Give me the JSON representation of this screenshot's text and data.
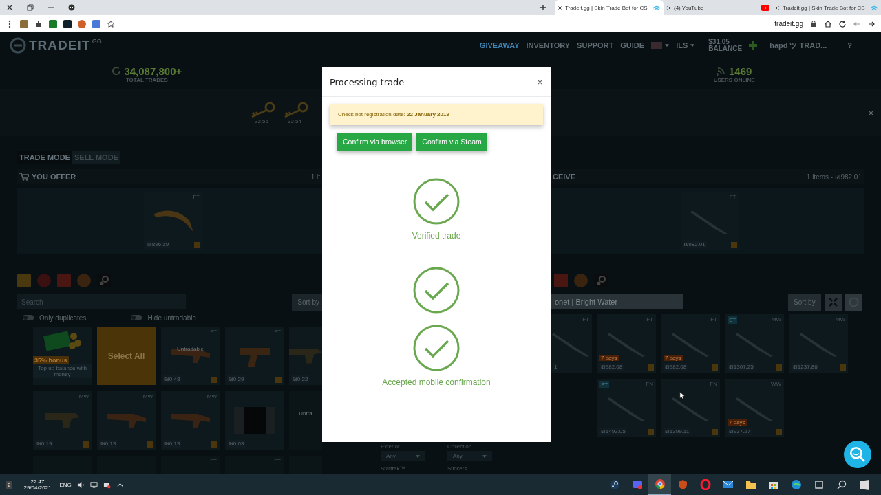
{
  "browser": {
    "tabs": [
      {
        "title": "Tradeit.gg | Skin Trade Bot for CS",
        "kind": "tradeit",
        "selected": true
      },
      {
        "title": "(4) YouTube",
        "kind": "youtube",
        "selected": false
      },
      {
        "title": "Tradeit.gg | Skin Trade Bot for CS",
        "kind": "tradeit",
        "selected": false
      }
    ],
    "address": "tradeit.gg"
  },
  "site": {
    "logo": "TRADEIT",
    "logo_suffix": ".GG",
    "nav": [
      {
        "label": "GIVEAWAY",
        "highlighted": true
      },
      {
        "label": "INVENTORY",
        "highlighted": false
      },
      {
        "label": "SUPPORT",
        "highlighted": false
      },
      {
        "label": "GUIDE",
        "highlighted": false
      }
    ],
    "currency": "ILS",
    "balance": "$31.05",
    "balance_label": "BALANCE",
    "user": "hapd ツ TRAD...",
    "help": "?"
  },
  "stats": [
    {
      "kind": "trades",
      "value": "34,087,800+",
      "label": "TOTAL TRADES"
    },
    {
      "kind": "online",
      "value": "1469",
      "label": "USERS ONLINE"
    }
  ],
  "keys": [
    {
      "price": "32.55"
    },
    {
      "price": "32.54"
    }
  ],
  "modes": [
    {
      "label": "TRADE MODE",
      "selected": true
    },
    {
      "label": "SELL MODE",
      "selected": false
    }
  ],
  "offer": {
    "title": "YOU OFFER",
    "count": "1 it",
    "items": [
      {
        "kind": "karambit",
        "wear": "FT",
        "price": "₪896.29"
      }
    ]
  },
  "receive": {
    "title": "CEIVE",
    "count": "1 items - ₪982.01",
    "items": [
      {
        "kind": "knife",
        "wear": "FT",
        "price": "₪982.01"
      }
    ]
  },
  "left_inventory": {
    "search_placeholder": "Search",
    "sort": "Sort by",
    "toggles": [
      {
        "label": "Only duplicates",
        "on": false
      },
      {
        "label": "Hide untradable",
        "on": false
      }
    ],
    "cards": [
      {
        "kind": "bonus",
        "badge": "35% bonus",
        "text": "Top up balance with money"
      },
      {
        "kind": "select_all",
        "label": "Select All"
      },
      {
        "kind": "rifle",
        "wear": "FT",
        "price": "₪0.48",
        "note": "Untradable"
      },
      {
        "kind": "pistol",
        "wear": "FT",
        "price": "₪0.29"
      },
      {
        "kind": "smg",
        "price": "₪0.22"
      },
      {
        "kind": "smg",
        "wear": "MW",
        "price": "₪0.19"
      },
      {
        "kind": "rifle",
        "wear": "MW",
        "price": "₪0.13"
      },
      {
        "kind": "rifle",
        "wear": "MW",
        "price": "₪0.13"
      },
      {
        "kind": "sticker",
        "price": "₪0.03"
      },
      {
        "kind": "blank",
        "note": "Untra"
      },
      {
        "kind": "blank"
      },
      {
        "kind": "blank"
      },
      {
        "kind": "blank",
        "wear": "FT"
      },
      {
        "kind": "blank",
        "wear": "FT"
      },
      {
        "kind": "blank"
      }
    ]
  },
  "right_inventory": {
    "search_value": "onet | Bright Water",
    "sort": "Sort by",
    "cards": [
      {
        "kind": "knife",
        "wear": "FT",
        "price": "1"
      },
      {
        "kind": "knife",
        "wear": "FT",
        "tag": "7 days",
        "price": "₪982.08"
      },
      {
        "kind": "knife",
        "wear": "FT",
        "tag": "7 days",
        "price": "₪982.08"
      },
      {
        "kind": "knife",
        "wear": "MW",
        "badge": "ST",
        "price": "₪1307.25"
      },
      {
        "kind": "knife",
        "wear": "MW",
        "price": "₪1237.86"
      },
      {
        "kind": "knife",
        "wear": "FN",
        "badge": "ST",
        "price": "₪1493.05"
      },
      {
        "kind": "knife",
        "wear": "FN",
        "price": "₪1399.11"
      },
      {
        "kind": "knife",
        "wear": "WW",
        "tag": "7 days",
        "price": "₪937.27"
      }
    ]
  },
  "filters": {
    "selects": [
      {
        "label": "Exterior",
        "value": "Any"
      },
      {
        "label": "Collection",
        "value": "Any"
      }
    ],
    "labels": [
      "Stattrak™",
      "Stickers"
    ]
  },
  "modal": {
    "title": "Processing trade",
    "alert": "Check bot registration date: **22 January 2019**",
    "buttons": [
      "Confirm via browser",
      "Confirm via Steam"
    ],
    "steps": [
      {
        "label": "Verified trade",
        "done": true
      },
      {
        "done": true
      },
      {
        "label": "Accepted mobile confirmation",
        "done": true
      }
    ]
  },
  "taskbar": {
    "notifications": "2",
    "time": "22:47",
    "date": "29/04/2021",
    "language": "ENG",
    "apps": [
      {
        "kind": "steam",
        "active": false
      },
      {
        "kind": "discord",
        "active": false
      },
      {
        "kind": "chrome",
        "active": true
      },
      {
        "kind": "shield",
        "active": false
      },
      {
        "kind": "opera",
        "active": false
      },
      {
        "kind": "mail",
        "active": false
      },
      {
        "kind": "folder",
        "active": false
      },
      {
        "kind": "store",
        "active": false
      },
      {
        "kind": "edge",
        "active": false
      },
      {
        "kind": "taskview",
        "active": false
      },
      {
        "kind": "search",
        "active": false
      },
      {
        "kind": "windows",
        "active": false
      }
    ]
  }
}
